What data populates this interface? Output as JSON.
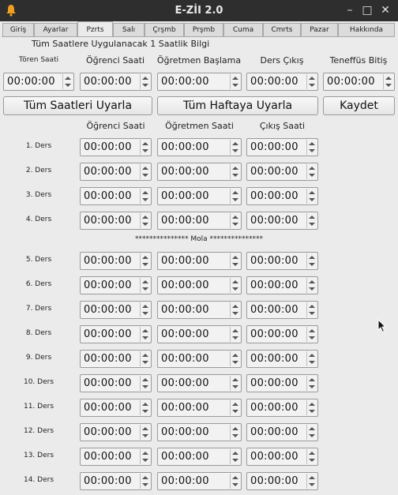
{
  "window": {
    "title": "E-ZİI 2.0"
  },
  "tabs": [
    "Giriş",
    "Ayarlar",
    "Pzrts",
    "Salı",
    "Çrşmb",
    "Prşmb",
    "Cuma",
    "Cmrts",
    "Pazar",
    "Hakkında"
  ],
  "active_tab": "Pzrts",
  "top": {
    "heading": "Tüm Saatlere Uygulanacak 1 Saatlik Bilgi",
    "labels": [
      "Tören Saati",
      "Öğrenci Saati",
      "Öğretmen Başlama",
      "Ders Çıkış",
      "Teneffüs Bitiş"
    ],
    "values": [
      "00:00:00",
      "00:00:00",
      "00:00:00",
      "00:00:00",
      "00:00:00"
    ]
  },
  "buttons": {
    "apply_all_hours": "Tüm Saatleri Uyarla",
    "apply_all_week": "Tüm Haftaya Uyarla",
    "save": "Kaydet"
  },
  "columns": [
    "Öğrenci Saati",
    "Öğretmen Saati",
    "Çıkış Saati"
  ],
  "break_label": "*************** Mola ***************",
  "lessons": [
    {
      "label": "1. Ders",
      "values": [
        "00:00:00",
        "00:00:00",
        "00:00:00"
      ]
    },
    {
      "label": "2. Ders",
      "values": [
        "00:00:00",
        "00:00:00",
        "00:00:00"
      ]
    },
    {
      "label": "3. Ders",
      "values": [
        "00:00:00",
        "00:00:00",
        "00:00:00"
      ]
    },
    {
      "label": "4. Ders",
      "values": [
        "00:00:00",
        "00:00:00",
        "00:00:00"
      ]
    },
    {
      "label": "5. Ders",
      "values": [
        "00:00:00",
        "00:00:00",
        "00:00:00"
      ]
    },
    {
      "label": "6. Ders",
      "values": [
        "00:00:00",
        "00:00:00",
        "00:00:00"
      ]
    },
    {
      "label": "7. Ders",
      "values": [
        "00:00:00",
        "00:00:00",
        "00:00:00"
      ]
    },
    {
      "label": "8. Ders",
      "values": [
        "00:00:00",
        "00:00:00",
        "00:00:00"
      ]
    },
    {
      "label": "9. Ders",
      "values": [
        "00:00:00",
        "00:00:00",
        "00:00:00"
      ]
    },
    {
      "label": "10. Ders",
      "values": [
        "00:00:00",
        "00:00:00",
        "00:00:00"
      ]
    },
    {
      "label": "11. Ders",
      "values": [
        "00:00:00",
        "00:00:00",
        "00:00:00"
      ]
    },
    {
      "label": "12. Ders",
      "values": [
        "00:00:00",
        "00:00:00",
        "00:00:00"
      ]
    },
    {
      "label": "13. Ders",
      "values": [
        "00:00:00",
        "00:00:00",
        "00:00:00"
      ]
    },
    {
      "label": "14. Ders",
      "values": [
        "00:00:00",
        "00:00:00",
        "00:00:00"
      ]
    }
  ],
  "icons": {
    "app": "bell-icon",
    "minimize": "minimize-icon",
    "maximize": "maximize-icon",
    "close": "close-icon",
    "cursor": "mouse-pointer-icon"
  }
}
